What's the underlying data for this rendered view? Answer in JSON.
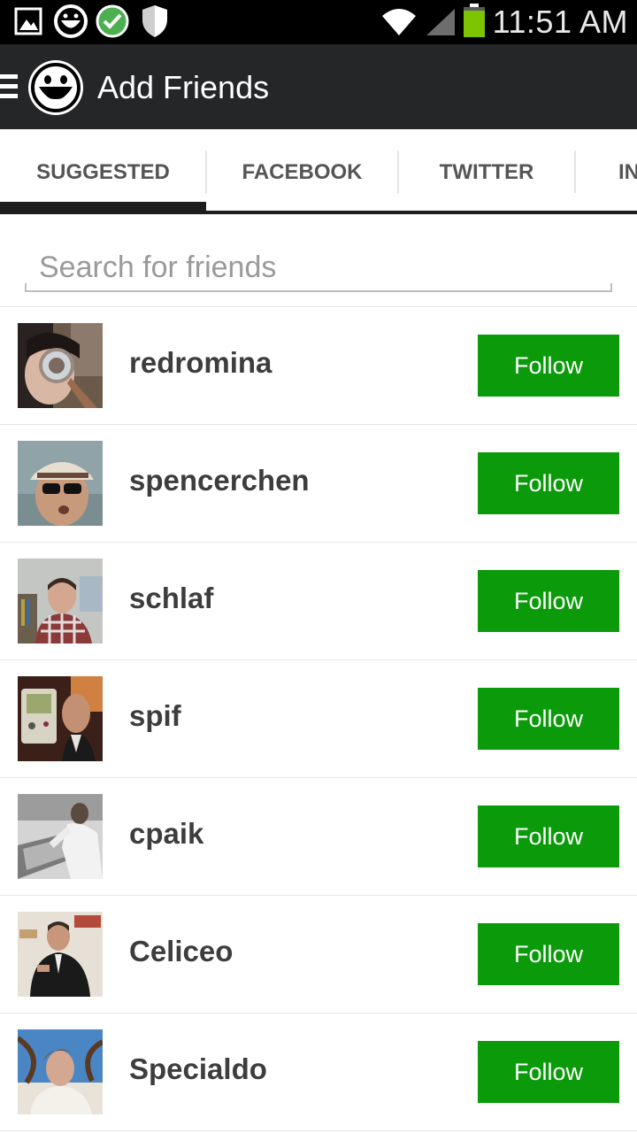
{
  "status_bar": {
    "time": "11:51 AM",
    "icons": [
      "gallery-icon",
      "app-smiley-icon",
      "check-circle-icon",
      "shield-icon",
      "wifi-icon",
      "signal-icon",
      "battery-icon"
    ]
  },
  "header": {
    "title": "Add Friends",
    "menu_icon": "hamburger-menu-icon",
    "logo_icon": "smiley-logo-icon"
  },
  "tabs": [
    {
      "label": "SUGGESTED",
      "selected": true
    },
    {
      "label": "FACEBOOK",
      "selected": false
    },
    {
      "label": "TWITTER",
      "selected": false
    },
    {
      "label": "IN",
      "selected": false
    }
  ],
  "search": {
    "placeholder": "Search for friends",
    "value": ""
  },
  "friends": [
    {
      "name": "redromina",
      "action": "Follow"
    },
    {
      "name": "spencerchen",
      "action": "Follow"
    },
    {
      "name": "schlaf",
      "action": "Follow"
    },
    {
      "name": "spif",
      "action": "Follow"
    },
    {
      "name": "cpaik",
      "action": "Follow"
    },
    {
      "name": "Celiceo",
      "action": "Follow"
    },
    {
      "name": "Specialdo",
      "action": "Follow"
    }
  ],
  "colors": {
    "status_bar_bg": "#000000",
    "action_bar_bg": "#252628",
    "follow_button_bg": "#0a9a0a",
    "tab_indicator": "#1e1e1e",
    "battery_green": "#7cc400"
  }
}
